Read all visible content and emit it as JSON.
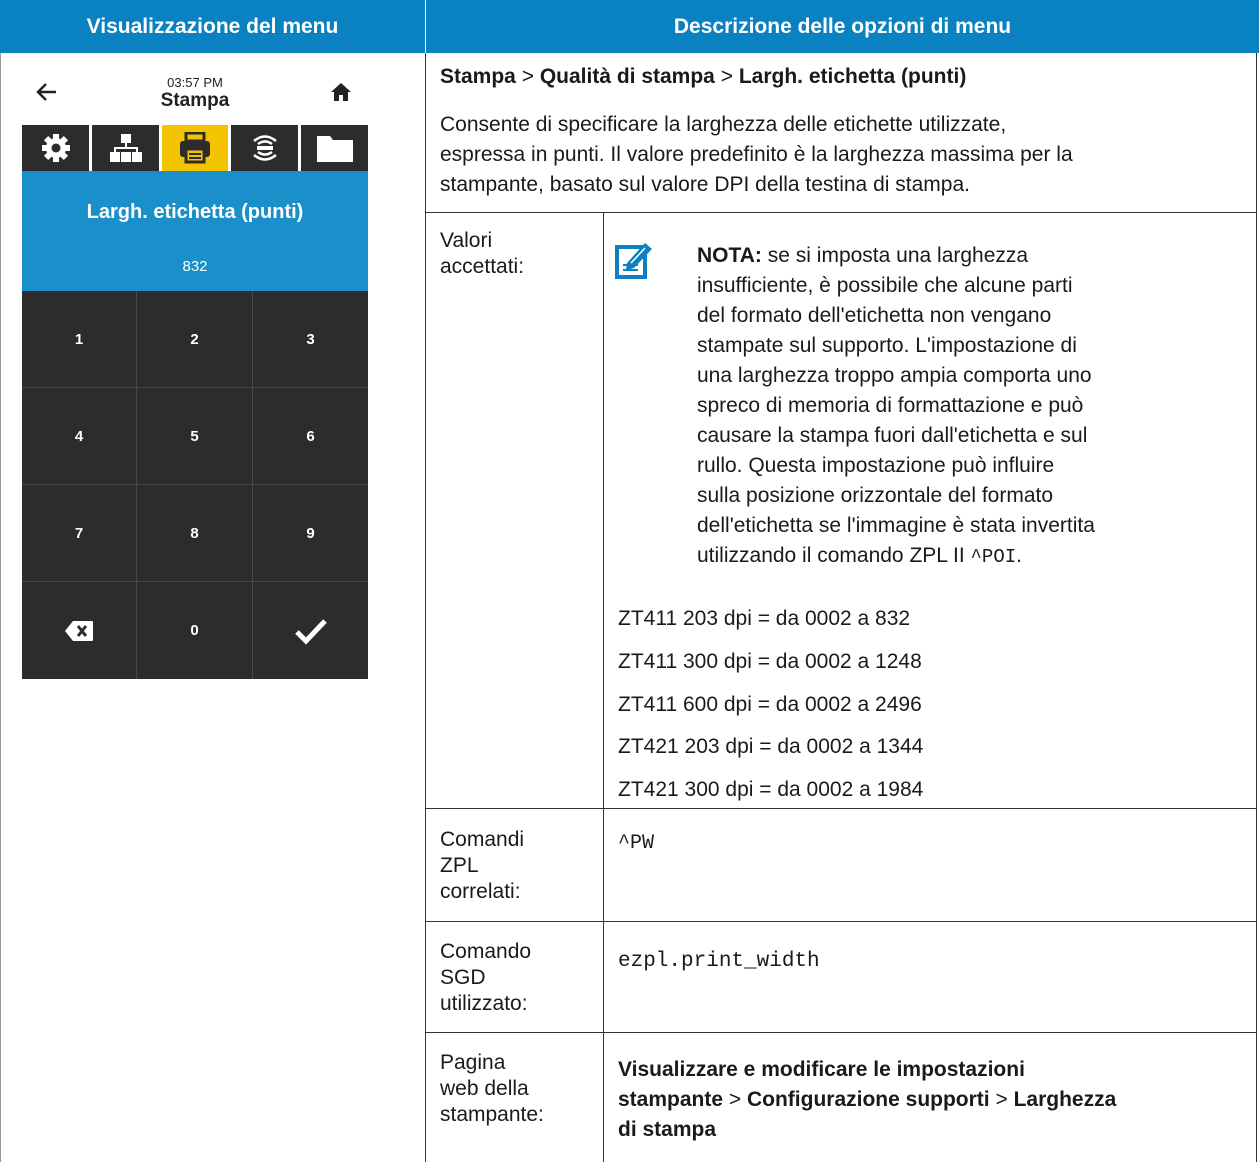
{
  "header": {
    "left": "Visualizzazione del menu",
    "right": "Descrizione delle opzioni di menu"
  },
  "device": {
    "time": "03:57 PM",
    "title": "Stampa",
    "field_label": "Largh. etichetta (punti)",
    "field_value": "832",
    "keys": [
      "1",
      "2",
      "3",
      "4",
      "5",
      "6",
      "7",
      "8",
      "9",
      "",
      "0",
      ""
    ],
    "icons": [
      "settings-icon",
      "network-icon",
      "printer-icon",
      "wireless-icon",
      "folder-icon"
    ],
    "active_icon": "printer-icon",
    "colors": {
      "accent": "#1a8fc9",
      "highlight": "#f5c400",
      "keypad": "#2c2c2c"
    }
  },
  "path": {
    "p1": "Stampa",
    "sep1": ">",
    "p2": "Qualità di stampa",
    "sep2": ">",
    "p3": "Largh. etichetta (punti)"
  },
  "description": {
    "line1": "Consente di specificare la larghezza delle etichette utilizzate,",
    "line2": "espressa in punti. Il valore predefinito è la larghezza massima per la",
    "line3": "stampante, basato sul valore DPI della testina di stampa."
  },
  "valori": {
    "label1": "Valori",
    "label2": "accettati:",
    "note_label": "NOTA:",
    "note_lines": [
      " se si imposta una larghezza",
      "insufficiente, è possibile che alcune parti",
      "del formato dell'etichetta non vengano",
      "stampate sul supporto. L'impostazione di",
      "una larghezza troppo ampia comporta uno",
      "spreco di memoria di formattazione e può",
      "causare la stampa fuori dall'etichetta e sul",
      "rullo. Questa impostazione può influire",
      "sulla posizione orizzontale del formato",
      "dell'etichetta se l'immagine è stata invertita",
      "utilizzando il comando ZPL II "
    ],
    "note_code": "^POI",
    "note_end": ".",
    "ranges": [
      "ZT411 203 dpi = da 0002 a 832",
      "ZT411 300 dpi = da 0002 a 1248",
      "ZT411 600 dpi = da 0002 a 2496",
      "ZT421 203 dpi = da 0002 a 1344",
      "ZT421 300 dpi = da 0002 a 1984"
    ]
  },
  "zpl": {
    "label": [
      "Comandi",
      "ZPL",
      "correlati:"
    ],
    "value": "^PW"
  },
  "sgd": {
    "label": [
      "Comando",
      "SGD",
      "utilizzato:"
    ],
    "value": "ezpl.print_width"
  },
  "web": {
    "label": [
      "Pagina",
      "web della",
      "stampante:"
    ],
    "p1": "Visualizzare e modificare le impostazioni",
    "p1b": "stampante",
    "sep1": ">",
    "p2": "Configurazione supporti",
    "sep2": ">",
    "p3a": "Larghezza",
    "p3b": "di stampa"
  }
}
